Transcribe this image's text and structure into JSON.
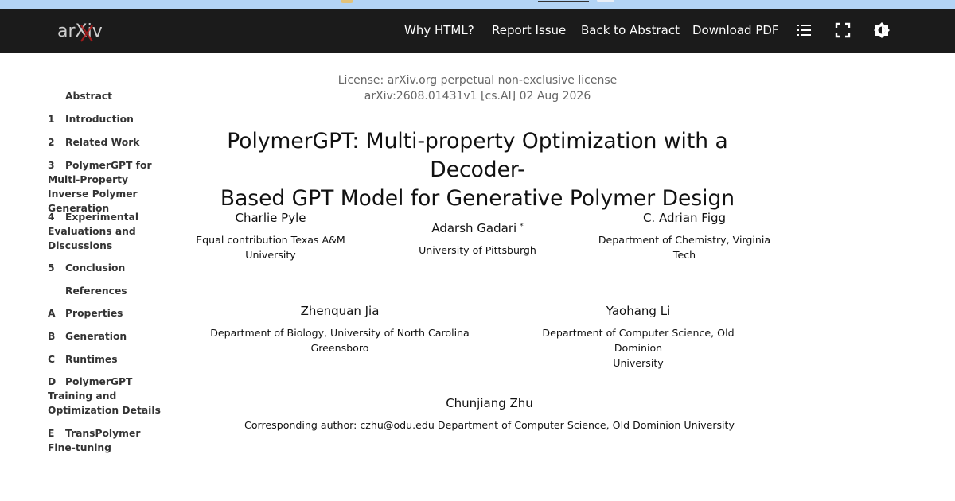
{
  "navbar": {
    "logo_text": "arXiv",
    "why_html": "Why HTML?",
    "report_issue": "Report Issue",
    "back_to_abstract": "Back to Abstract",
    "download_pdf": "Download PDF",
    "toc_icon": "list-icon",
    "fullscreen_icon": "fullscreen-icon",
    "theme_icon": "theme-toggle-icon"
  },
  "toc": [
    {
      "num": "",
      "label": "Abstract"
    },
    {
      "num": "1",
      "label": "Introduction"
    },
    {
      "num": "2",
      "label": "Related Work"
    },
    {
      "num": "3",
      "label": "PolymerGPT for Multi-Property Inverse Polymer Generation"
    },
    {
      "num": "4",
      "label": "Experimental Evaluations and Discussions"
    },
    {
      "num": "5",
      "label": "Conclusion"
    },
    {
      "num": "",
      "label": "References"
    },
    {
      "num": "A",
      "label": "Properties"
    },
    {
      "num": "B",
      "label": "Generation"
    },
    {
      "num": "C",
      "label": "Runtimes"
    },
    {
      "num": "D",
      "label": "PolymerGPT Training and Optimization Details"
    },
    {
      "num": "E",
      "label": "TransPolymer Fine-tuning"
    }
  ],
  "header": {
    "license": "License: arXiv.org perpetual non-exclusive license",
    "arxiv_id": "arXiv:2608.01431v1 [cs.AI] 02 Aug 2026"
  },
  "paper": {
    "title_line1": "PolymerGPT: Multi-property Optimization with a Decoder-",
    "title_line2": "Based GPT Model for Generative Polymer Design",
    "authors": [
      {
        "name": "Charlie Pyle",
        "aff1": "Equal contribution Texas A&M",
        "aff2": "University"
      },
      {
        "name": "Adarsh Gadari",
        "mark": "*",
        "aff1": "University of Pittsburgh",
        "aff2": ""
      },
      {
        "name": "C. Adrian Figg",
        "aff1": "Department of Chemistry, Virginia",
        "aff2": "Tech"
      },
      {
        "name": "Zhenquan Jia",
        "aff1": "Department of Biology, University of North Carolina",
        "aff2": "Greensboro"
      },
      {
        "name": "Yaohang Li",
        "aff1": "Department of Computer Science, Old Dominion",
        "aff2": "University"
      },
      {
        "name": "Chunjiang Zhu",
        "aff1": "Corresponding author: czhu@odu.edu Department of Computer Science, Old Dominion University",
        "aff2": ""
      }
    ]
  }
}
